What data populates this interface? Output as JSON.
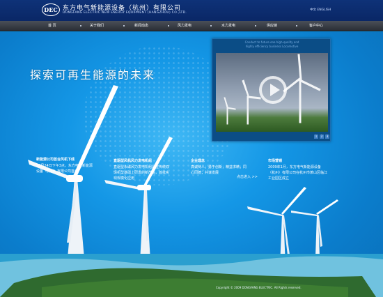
{
  "header": {
    "logo_text": "DEC",
    "company_cn": "东方电气新能源设备（杭州）有限公司",
    "company_en": "DONGFANG ELECTRIC NEW ENERGY EQUIPMENT (HANGZHOU) CO.,LTD.",
    "lang": "中文 ENGLISH"
  },
  "nav": {
    "items": [
      {
        "label": "首  页"
      },
      {
        "label": "关于我们"
      },
      {
        "label": "新闻动态"
      },
      {
        "label": "风力发电"
      },
      {
        "label": "水力发电"
      },
      {
        "label": "供应链"
      },
      {
        "label": "客户中心"
      }
    ]
  },
  "hero": {
    "slogan": "探索可再生能源的未来"
  },
  "video": {
    "caption_line1": "Conduct to future one high-quality and",
    "caption_line2": "highly efficiency business Locomotive",
    "pages": [
      "1",
      "2",
      "3"
    ]
  },
  "columns": [
    {
      "title": "新能源公司首台风机下线",
      "body": "10月24日下午3点，东方电气新能源设备（杭州）有限公司首台"
    },
    {
      "title": "直驱型风机风力发电机组",
      "body": "直驱型永磁风力发电机组是在传统双馈机型基础上研发的新产品，首批实现规模化应用"
    },
    {
      "title": "企业理念",
      "body": "真诚待人；勇于创新；精益求精；同心同德；共谋发展",
      "more": "点击进入 >>"
    },
    {
      "title": "市场营销",
      "body": "2009年1月，东方电气新能源设备（杭州）有限公司在杭州市萧山区临江工业园区成立"
    }
  ],
  "footer": {
    "copyright": "Copyright © 2009 DONGFANG ELECTRIC. All Rights reserved."
  },
  "colors": {
    "header_bg": "#0e3278",
    "nav_bg": "#3a3f48",
    "hero_blue": "#1497e6"
  }
}
